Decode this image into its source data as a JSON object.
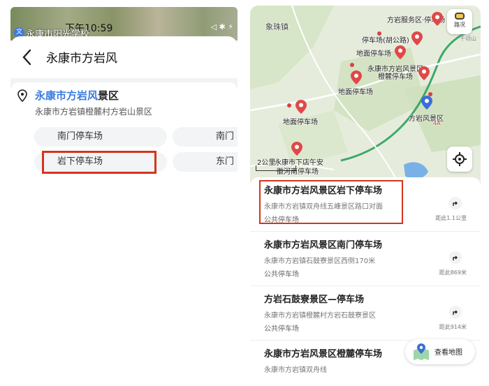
{
  "left_panel": {
    "status": {
      "app_place": "永康市阳光学校",
      "clock": "下午10:59",
      "app_icon_text": "文",
      "sys_icons": "◁ ✱ ⚡"
    },
    "search": {
      "query": "永康市方岩风"
    },
    "suggestion": {
      "title_highlight": "永康市方岩风",
      "title_rest": "景区",
      "address": "永康市方岩镇橙麓村方岩山景区",
      "chips": [
        "南门停车场",
        "南门",
        "岩下停车场",
        "东门"
      ]
    }
  },
  "map": {
    "labels": {
      "town": "象珠镇",
      "service": "方岩服务区·停车场",
      "hu_gong": "停车场(胡公路)",
      "ground1": "地面停车场",
      "chenglu": "永康市方岩风景区橙麓停车场",
      "ground2": "地面停车场",
      "ground3": "地面停车场",
      "scenic": "方岩风景区",
      "scenic_grade": "4A",
      "xiadian": "永康市下店午安",
      "dongbo": "徽河南停车场",
      "scale": "2公里",
      "corner": "千顷山"
    },
    "road_button": "路况",
    "colors": {
      "marker": "#e04848",
      "scenic_marker": "#3a6fd8",
      "water": "#7ab0e8"
    }
  },
  "results": [
    {
      "title": "永康市方岩风景区岩下停车场",
      "address": "永康市方岩镇双舟线五峰景区路口对面",
      "type": "公共停车场",
      "distance": "距此1.1公里"
    },
    {
      "title": "永康市方岩风景区南门停车场",
      "address": "永康市方岩镇石鼓寮景区西侧170米",
      "type": "公共停车场",
      "distance": "距此869米"
    },
    {
      "title": "方岩石鼓寮景区—停车场",
      "address": "永康市方岩镇橙麓村方岩石鼓寮景区",
      "type": "公共停车场",
      "distance": "距此914米"
    },
    {
      "title": "永康市方岩风景区橙麓停车场",
      "address": "永康市方岩镇双舟线",
      "type": "",
      "distance": ""
    }
  ],
  "view_map_label": "查看地图"
}
